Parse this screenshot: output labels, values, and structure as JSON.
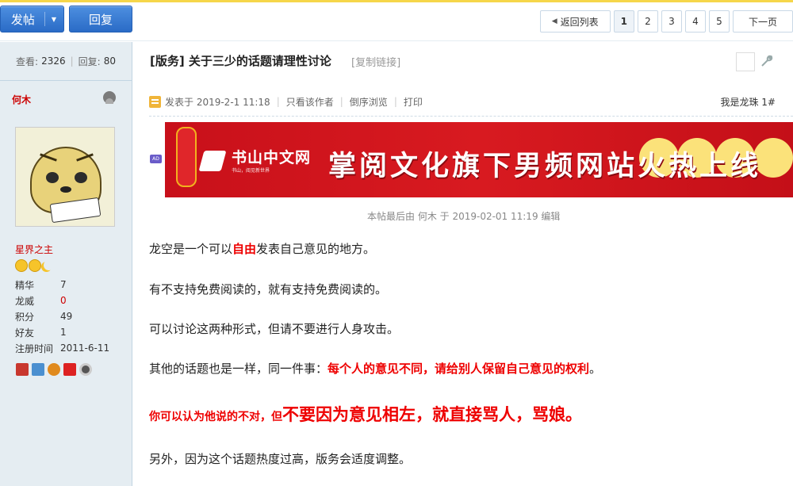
{
  "toolbar": {
    "post_label": "发帖",
    "reply_label": "回复"
  },
  "pager": {
    "back_label": "返回列表",
    "pages": [
      "1",
      "2",
      "3",
      "4",
      "5"
    ],
    "next_label": "下一页"
  },
  "sidebar": {
    "views_label": "查看:",
    "views": "2326",
    "replies_label": "回复:",
    "replies": "80",
    "author_name": "何木",
    "rank": "星界之主",
    "profile": [
      {
        "key": "精华",
        "value": "7"
      },
      {
        "key": "龙威",
        "value": "0"
      },
      {
        "key": "积分",
        "value": "49"
      },
      {
        "key": "好友",
        "value": "1"
      },
      {
        "key": "注册时间",
        "value": "2011-6-11"
      }
    ]
  },
  "post": {
    "title": "[版务] 关于三少的话题请理性讨论",
    "copy_link": "[复制链接]",
    "meta": {
      "posted_at": "发表于 2019-2-1 11:18",
      "only_author": "只看该作者",
      "reverse": "倒序浏览",
      "print": "打印",
      "floor": "我是龙珠 1#"
    },
    "ad": {
      "badge": "AD",
      "brand": "书山中文网",
      "brand_sub": "书山，阅见新世界",
      "slogan": "掌阅文化旗下男频网站火热上线"
    },
    "edited_note": "本帖最后由 何木 于 2019-02-01 11:19 编辑",
    "p1_a": "龙空是一个可以",
    "p1_b": "自由",
    "p1_c": "发表自己意见的地方。",
    "p2": "有不支持免费阅读的，就有支持免费阅读的。",
    "p3": "可以讨论这两种形式，但请不要进行人身攻击。",
    "p4_a": "其他的话题也是一样，同一件事：",
    "p4_b": "每个人的意见不同，请给别人保留自己意见的权利",
    "p4_c": "。",
    "p5_a": "你可以认为他说的不对，但",
    "p5_b": "不要因为意见相左，就直接骂人，骂娘。",
    "p6": "另外，因为这个话题热度过高，版务会适度调整。"
  }
}
